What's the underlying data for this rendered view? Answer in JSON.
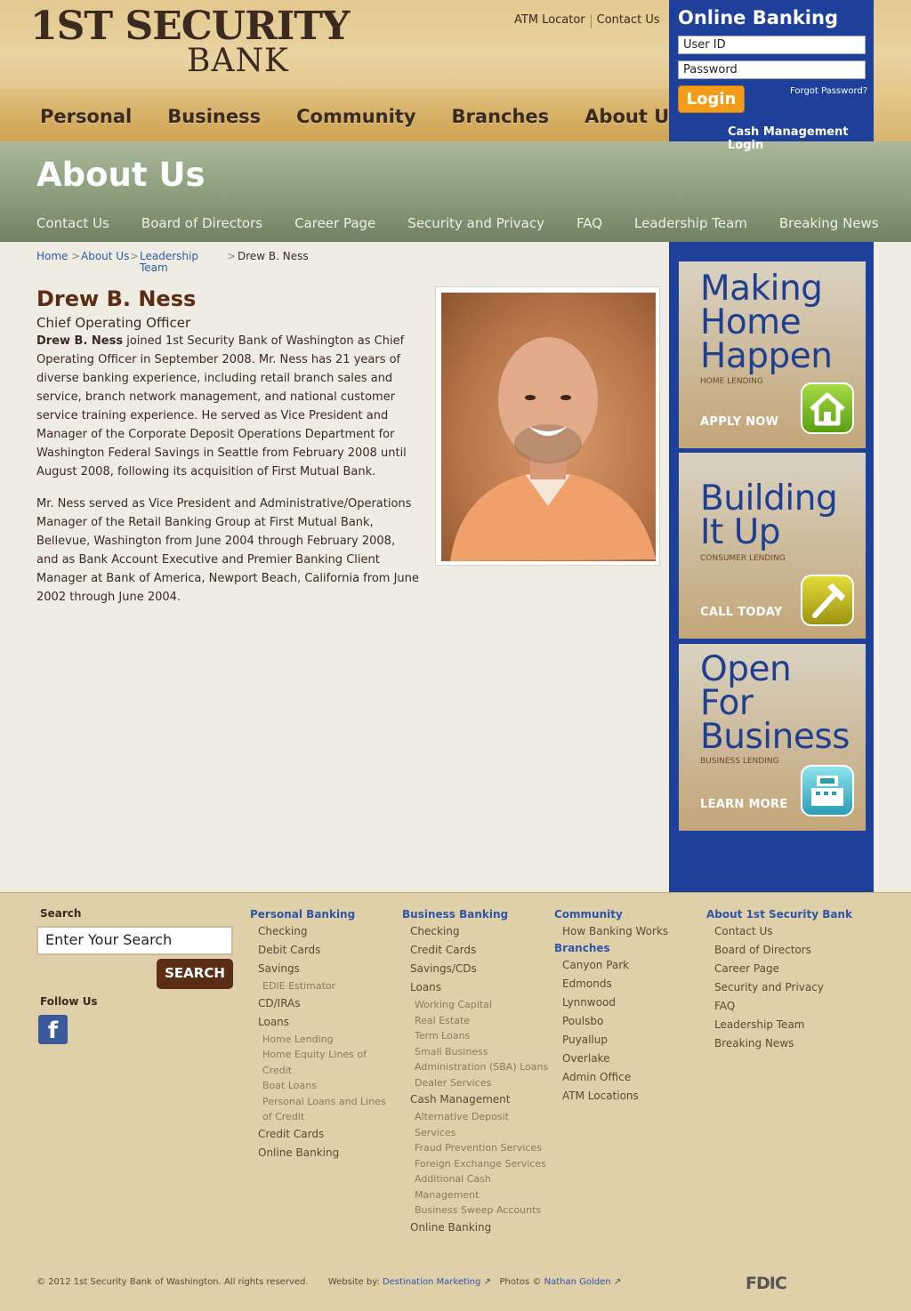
{
  "header": {
    "logo_line1": "1ST SECURITY",
    "logo_line2": "BANK",
    "top_links": [
      "ATM Locator",
      "Contact Us"
    ],
    "main_nav": [
      "Personal",
      "Business",
      "Community",
      "Branches",
      "About Us"
    ]
  },
  "online_banking": {
    "title": "Online Banking",
    "user_id_placeholder": "User ID",
    "password_placeholder": "Password",
    "login_label": "Login",
    "forgot_label": "Forgot Password?",
    "cash_mgmt_label": "Cash Management Login"
  },
  "banner": {
    "title": "About Us",
    "subnav": [
      "Contact Us",
      "Board of Directors",
      "Career Page",
      "Security and Privacy",
      "FAQ",
      "Leadership Team",
      "Breaking News"
    ]
  },
  "breadcrumb": {
    "home": "Home",
    "about": "About Us",
    "leadership_line1": "Leadership",
    "leadership_line2": "Team",
    "current": "Drew B. Ness",
    "sep": ">"
  },
  "profile": {
    "name": "Drew B. Ness",
    "title": "Chief Operating Officer",
    "para1_bold": "Drew B. Ness",
    "para1_rest": " joined 1st Security Bank of Washington as Chief Operating Officer in September 2008. Mr. Ness has 21 years of diverse banking experience, including retail branch sales and service, branch network management, and national customer service training experience. He served as Vice President and Manager of the Corporate Deposit Operations Department for Washington Federal Savings in Seattle from February 2008 until August 2008, following its acquisition of First Mutual Bank.",
    "para2": "Mr. Ness served as Vice President and Administrative/Operations Manager of the Retail Banking Group at First Mutual Bank, Bellevue, Washington from June 2004 through February 2008, and as Bank Account Executive and Premier Banking Client Manager at Bank of America, Newport Beach, California from June 2002 through June 2004."
  },
  "promos": [
    {
      "head": [
        "Making",
        "Home",
        "Happen"
      ],
      "sub": "HOME LENDING",
      "cta": "APPLY NOW",
      "icon": "house-icon",
      "color": "#7fbf2a"
    },
    {
      "head": [
        "Building",
        "It Up"
      ],
      "sub": "CONSUMER LENDING",
      "cta": "CALL TODAY",
      "icon": "hammer-icon",
      "color": "#b9b21c"
    },
    {
      "head": [
        "Open",
        "For",
        "Business"
      ],
      "sub": "BUSINESS LENDING",
      "cta": "LEARN MORE",
      "icon": "register-icon",
      "color": "#3fb4c9"
    }
  ],
  "footer": {
    "search_label": "Search",
    "search_placeholder": "Enter Your Search",
    "search_button": "SEARCH",
    "follow_label": "Follow Us",
    "facebook_glyph": "f",
    "personal": {
      "heading": "Personal Banking",
      "items": [
        {
          "t": "Checking",
          "k": "i"
        },
        {
          "t": "Debit Cards",
          "k": "i"
        },
        {
          "t": "Savings",
          "k": "i"
        },
        {
          "t": "EDIE Estimator",
          "k": "s"
        },
        {
          "t": "CD/IRAs",
          "k": "i"
        },
        {
          "t": "Loans",
          "k": "i"
        },
        {
          "t": "Home Lending",
          "k": "s"
        },
        {
          "t": "Home Equity Lines of",
          "k": "s"
        },
        {
          "t": "Credit",
          "k": "s"
        },
        {
          "t": "Boat Loans",
          "k": "s"
        },
        {
          "t": "Personal Loans and Lines",
          "k": "s"
        },
        {
          "t": "of Credit",
          "k": "s"
        },
        {
          "t": "Credit Cards",
          "k": "i"
        },
        {
          "t": "Online Banking",
          "k": "i"
        }
      ]
    },
    "business": {
      "heading": "Business Banking",
      "items": [
        {
          "t": "Checking",
          "k": "i"
        },
        {
          "t": "Credit Cards",
          "k": "i"
        },
        {
          "t": "Savings/CDs",
          "k": "i"
        },
        {
          "t": "Loans",
          "k": "i"
        },
        {
          "t": "Working Capital",
          "k": "s"
        },
        {
          "t": "Real Estate",
          "k": "s"
        },
        {
          "t": "Term Loans",
          "k": "s"
        },
        {
          "t": "Small Business",
          "k": "s"
        },
        {
          "t": "Administration (SBA) Loans",
          "k": "s"
        },
        {
          "t": "Dealer Services",
          "k": "s"
        },
        {
          "t": "Cash Management",
          "k": "i"
        },
        {
          "t": "Alternative Deposit",
          "k": "s"
        },
        {
          "t": "Services",
          "k": "s"
        },
        {
          "t": "Fraud Prevention Services",
          "k": "s"
        },
        {
          "t": "Foreign Exchange Services",
          "k": "s"
        },
        {
          "t": "Additional Cash",
          "k": "s"
        },
        {
          "t": "Management",
          "k": "s"
        },
        {
          "t": "Business Sweep Accounts",
          "k": "s"
        },
        {
          "t": "Online Banking",
          "k": "i"
        }
      ]
    },
    "community": {
      "heading": "Community",
      "items": [
        {
          "t": "How Banking Works",
          "k": "i"
        }
      ],
      "heading2": "Branches",
      "items2": [
        {
          "t": "Canyon Park",
          "k": "i"
        },
        {
          "t": "Edmonds",
          "k": "i"
        },
        {
          "t": "Lynnwood",
          "k": "i"
        },
        {
          "t": "Poulsbo",
          "k": "i"
        },
        {
          "t": "Puyallup",
          "k": "i"
        },
        {
          "t": "Overlake",
          "k": "i"
        },
        {
          "t": "Admin Office",
          "k": "i"
        },
        {
          "t": "ATM Locations",
          "k": "i"
        }
      ]
    },
    "about": {
      "heading": "About 1st Security Bank",
      "items": [
        {
          "t": "Contact Us",
          "k": "i"
        },
        {
          "t": "Board of Directors",
          "k": "i"
        },
        {
          "t": "Career Page",
          "k": "i"
        },
        {
          "t": "Security and Privacy",
          "k": "i"
        },
        {
          "t": "FAQ",
          "k": "i"
        },
        {
          "t": "Leadership Team",
          "k": "i"
        },
        {
          "t": "Breaking News",
          "k": "i"
        }
      ]
    },
    "copyright": "© 2012 1st Security Bank of Washington. All rights reserved.",
    "website_by_label": "Website by:",
    "website_by_link": "Destination Marketing",
    "photos_label": "Photos ©",
    "photos_link": "Nathan Golden",
    "fdic": "FDIC"
  }
}
